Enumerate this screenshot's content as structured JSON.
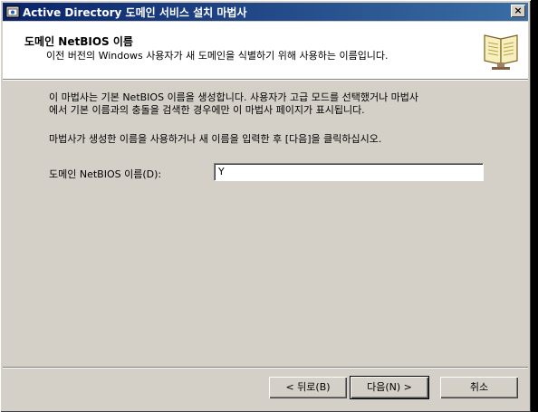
{
  "window": {
    "title": "Active Directory 도메인 서비스 설치 마법사",
    "close_label": "×"
  },
  "header": {
    "title": "도메인 NetBIOS 이름",
    "subtitle": "이전 버전의 Windows 사용자가 새 도메인을 식별하기 위해 사용하는 이름입니다."
  },
  "body": {
    "paragraph1_line1": "이 마법사는 기본 NetBIOS 이름을 생성합니다. 사용자가 고급 모드를 선택했거나 마법사",
    "paragraph1_line2": "에서 기본 이름과의 충돌을 검색한 경우에만 이 마법사 페이지가 표시됩니다.",
    "paragraph2": "마법사가 생성한 이름을 사용하거나 새 이름을 입력한 후 [다음]을 클릭하십시오."
  },
  "field": {
    "label": "도메인 NetBIOS 이름(D):",
    "value": "Y"
  },
  "buttons": {
    "back": "< 뒤로(B)",
    "next": "다음(N) >",
    "cancel": "취소"
  }
}
